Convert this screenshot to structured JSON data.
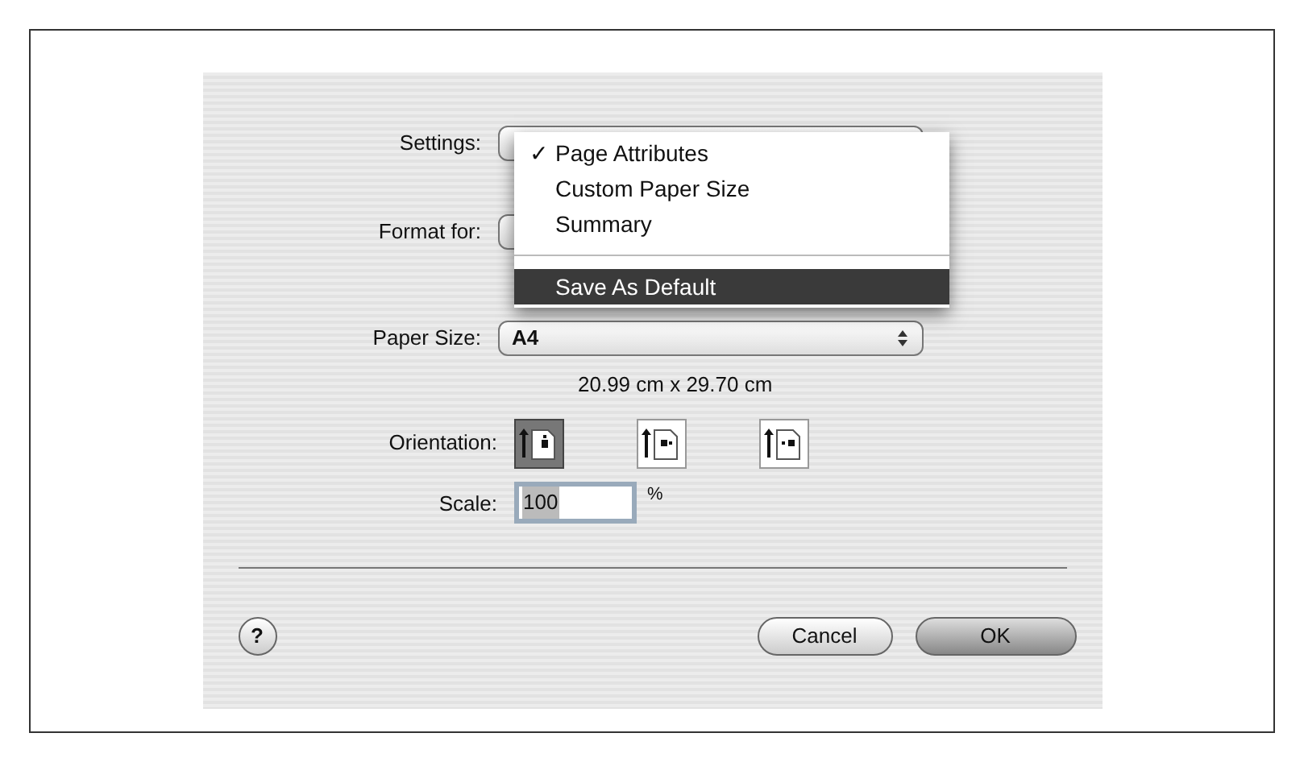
{
  "settings": {
    "label": "Settings:",
    "menu": [
      {
        "label": "Page Attributes",
        "checked": true,
        "selected": false
      },
      {
        "label": "Custom Paper Size",
        "checked": false,
        "selected": false
      },
      {
        "label": "Summary",
        "checked": false,
        "selected": false
      },
      {
        "kind": "separator"
      },
      {
        "label": "Save As Default",
        "checked": false,
        "selected": true
      }
    ],
    "check_mark": "✓"
  },
  "format_for": {
    "label": "Format for:"
  },
  "paper_size": {
    "label": "Paper Size:",
    "value": "A4",
    "dimensions": "20.99 cm x 29.70 cm"
  },
  "orientation": {
    "label": "Orientation:",
    "options": [
      {
        "kind": "portrait",
        "selected": true
      },
      {
        "kind": "landscape-left",
        "selected": false
      },
      {
        "kind": "landscape-right",
        "selected": false
      }
    ]
  },
  "scale": {
    "label": "Scale:",
    "value": "100",
    "unit": "%"
  },
  "help": "?",
  "buttons": [
    {
      "label": "Cancel",
      "default": false
    },
    {
      "label": "OK",
      "default": true
    }
  ]
}
